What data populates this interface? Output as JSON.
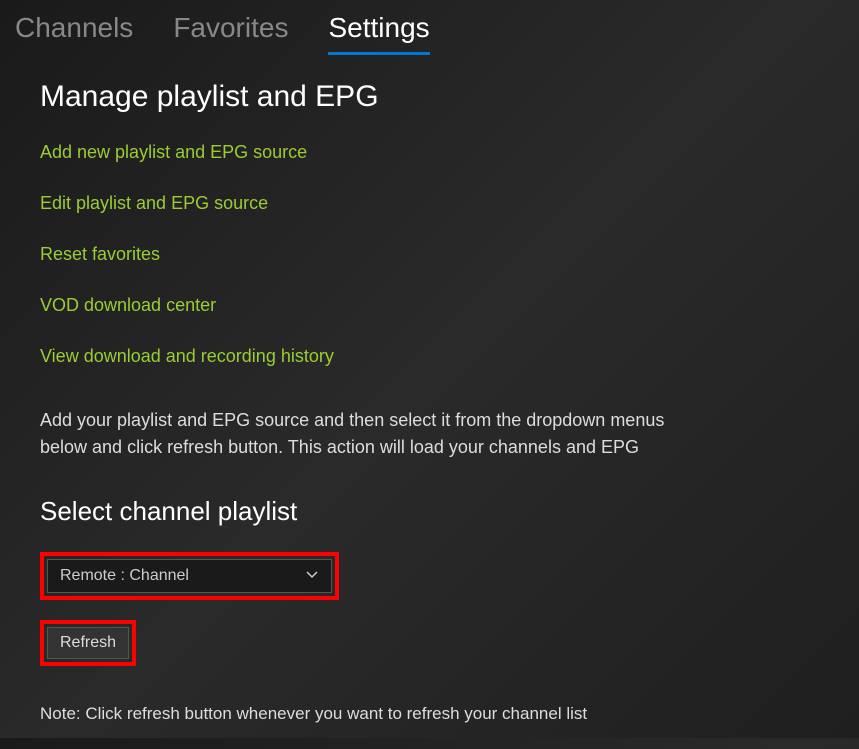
{
  "tabs": {
    "channels": "Channels",
    "favorites": "Favorites",
    "settings": "Settings"
  },
  "headings": {
    "manage": "Manage playlist and EPG",
    "select_playlist": "Select channel playlist"
  },
  "links": {
    "add_source": "Add new playlist and EPG source",
    "edit_source": "Edit playlist and EPG source",
    "reset_favorites": "Reset favorites",
    "vod_center": "VOD download center",
    "view_history": "View download and recording history"
  },
  "info_text": "Add your playlist and EPG source and then select it from the dropdown menus below and click refresh button. This action will load your channels and EPG",
  "dropdown": {
    "selected": "Remote : Channel"
  },
  "buttons": {
    "refresh": "Refresh"
  },
  "note": "Note: Click refresh button whenever you want to refresh your channel list"
}
